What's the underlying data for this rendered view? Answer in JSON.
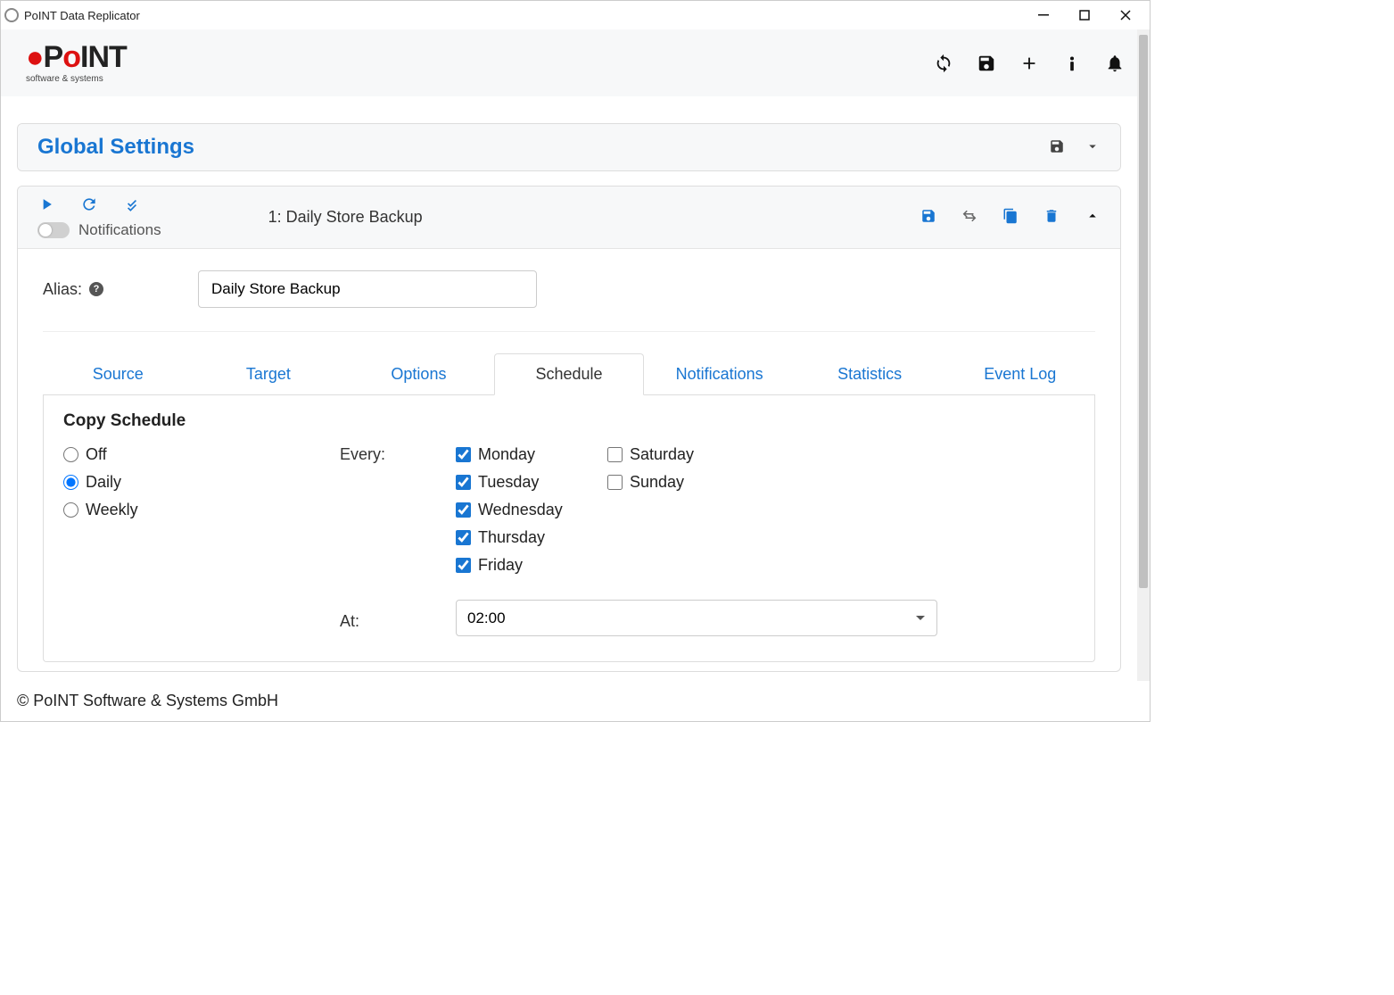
{
  "window": {
    "title": "PoINT Data Replicator"
  },
  "logo": {
    "main": "PoINT",
    "sub": "software & systems"
  },
  "global_panel": {
    "title": "Global Settings"
  },
  "job": {
    "title": "1:  Daily Store Backup",
    "notifications_label": "Notifications",
    "alias_label": "Alias:",
    "alias_value": "Daily Store Backup"
  },
  "tabs": {
    "source": "Source",
    "target": "Target",
    "options": "Options",
    "schedule": "Schedule",
    "notifications": "Notifications",
    "statistics": "Statistics",
    "eventlog": "Event Log"
  },
  "schedule": {
    "section_title": "Copy Schedule",
    "mode": {
      "off": "Off",
      "daily": "Daily",
      "weekly": "Weekly"
    },
    "every_label": "Every:",
    "days": {
      "monday": "Monday",
      "tuesday": "Tuesday",
      "wednesday": "Wednesday",
      "thursday": "Thursday",
      "friday": "Friday",
      "saturday": "Saturday",
      "sunday": "Sunday"
    },
    "days_checked": {
      "monday": true,
      "tuesday": true,
      "wednesday": true,
      "thursday": true,
      "friday": true,
      "saturday": false,
      "sunday": false
    },
    "at_label": "At:",
    "at_value": "02:00"
  },
  "footer": "© PoINT Software & Systems GmbH"
}
